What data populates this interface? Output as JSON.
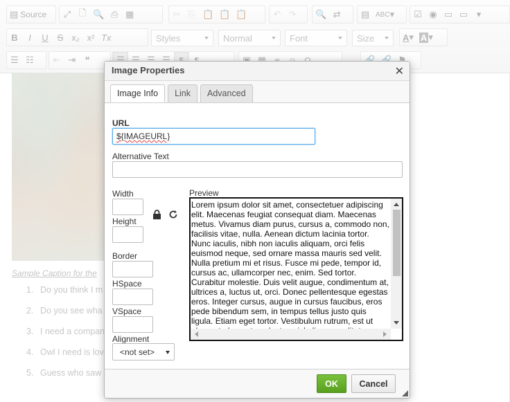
{
  "toolbar": {
    "source_label": "Source",
    "styles_placeholder": "Styles",
    "format_placeholder": "Normal",
    "font_placeholder": "Font",
    "size_placeholder": "Size",
    "bold": "B",
    "italic": "I",
    "underline": "U",
    "strike": "S",
    "subscript": "x₂",
    "superscript": "x²",
    "remove_format": "Tx",
    "text_color": "A",
    "bg_color": "A"
  },
  "editor": {
    "caption": "Sample Caption for the",
    "list_items": [
      {
        "num": "1.",
        "text": "Do you think I m"
      },
      {
        "num": "2.",
        "text": "Do you see wha"
      },
      {
        "num": "3.",
        "text": "I need a compan"
      },
      {
        "num": "4.",
        "text": "Owl I need is lov"
      },
      {
        "num": "5.",
        "text": "Guess who saw"
      }
    ]
  },
  "dialog": {
    "title": "Image Properties",
    "close_glyph": "✕",
    "tabs": [
      {
        "label": "Image Info",
        "active": true
      },
      {
        "label": "Link",
        "active": false
      },
      {
        "label": "Advanced",
        "active": false
      }
    ],
    "url_label": "URL",
    "url_value": "${IMAGEURL}",
    "alt_label": "Alternative Text",
    "alt_value": "",
    "width_label": "Width",
    "height_label": "Height",
    "border_label": "Border",
    "hspace_label": "HSpace",
    "vspace_label": "VSpace",
    "alignment_label": "Alignment",
    "alignment_value": "<not set>",
    "preview_label": "Preview",
    "preview_text": "Lorem ipsum dolor sit amet, consectetuer adipiscing elit. Maecenas feugiat consequat diam. Maecenas metus. Vivamus diam purus, cursus a, commodo non, facilisis vitae, nulla. Aenean dictum lacinia tortor. Nunc iaculis, nibh non iaculis aliquam, orci felis euismod neque, sed ornare massa mauris sed velit. Nulla pretium mi et risus. Fusce mi pede, tempor id, cursus ac, ullamcorper nec, enim. Sed tortor. Curabitur molestie. Duis velit augue, condimentum at, ultrices a, luctus ut, orci. Donec pellentesque egestas eros. Integer cursus, augue in cursus faucibus, eros pede bibendum sem, in tempus tellus justo quis ligula. Etiam eget tortor. Vestibulum rutrum, est ut placerat elementum, lectus nisl aliquam velit, tempor aliquam eros nunc nonummy metus.",
    "ok_label": "OK",
    "cancel_label": "Cancel"
  },
  "colors": {
    "ok_green": "#5aa01f",
    "focus_blue": "#51a7e8"
  }
}
